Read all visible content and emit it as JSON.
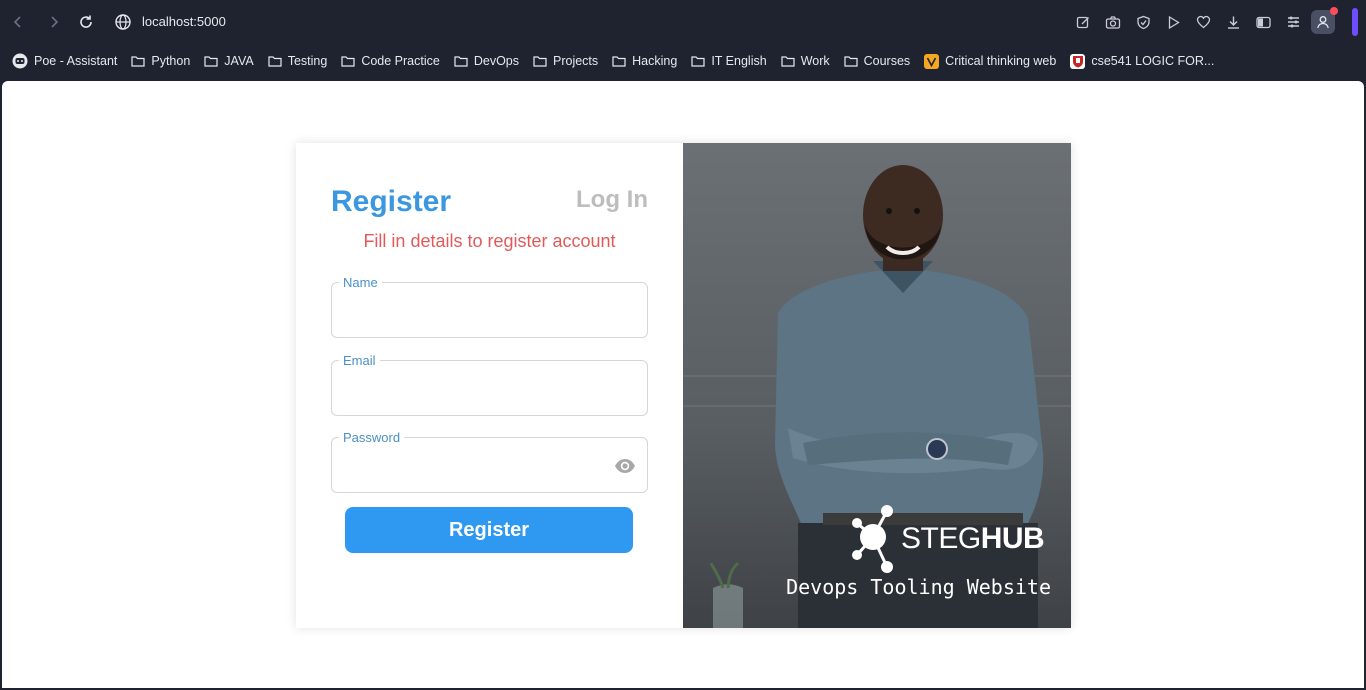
{
  "browser": {
    "url": "localhost:5000",
    "bookmarks": [
      {
        "label": "Poe - Assistant",
        "icon": "poe-icon"
      },
      {
        "label": "Python",
        "icon": "folder-icon"
      },
      {
        "label": "JAVA",
        "icon": "folder-icon"
      },
      {
        "label": "Testing",
        "icon": "folder-icon"
      },
      {
        "label": "Code Practice",
        "icon": "folder-icon"
      },
      {
        "label": "DevOps",
        "icon": "folder-icon"
      },
      {
        "label": "Projects",
        "icon": "folder-icon"
      },
      {
        "label": "Hacking",
        "icon": "folder-icon"
      },
      {
        "label": "IT English",
        "icon": "folder-icon"
      },
      {
        "label": "Work",
        "icon": "folder-icon"
      },
      {
        "label": "Courses",
        "icon": "folder-icon"
      },
      {
        "label": "Critical thinking web",
        "icon": "critical-thinking-icon"
      },
      {
        "label": "cse541 LOGIC FOR...",
        "icon": "shield-crest-icon"
      }
    ]
  },
  "auth": {
    "register_tab": "Register",
    "login_tab": "Log In",
    "subtitle": "Fill in details to register account",
    "fields": {
      "name_label": "Name",
      "email_label": "Email",
      "password_label": "Password"
    },
    "submit_label": "Register"
  },
  "branding": {
    "logo_text_light": "STEG",
    "logo_text_bold": "HUB",
    "tagline": "Devops Tooling Website"
  },
  "colors": {
    "accent": "#2f98f0",
    "register_tab": "#3a97e0",
    "subtitle": "#e05a5a",
    "inactive_tab": "#bdbdbd"
  }
}
